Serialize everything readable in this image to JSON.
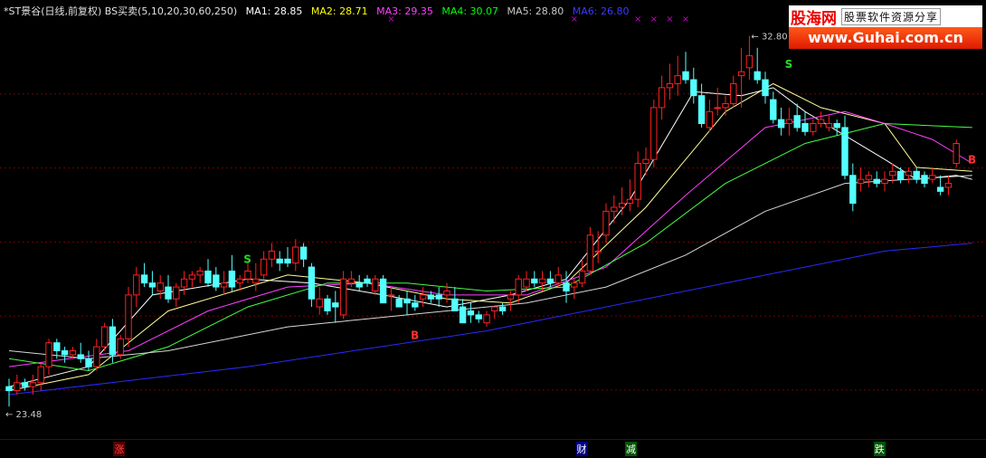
{
  "header": {
    "title": "*ST景谷(日线,前复权) BS买卖(5,10,20,30,60,250)",
    "ma": [
      {
        "label": "MA1: 28.85",
        "color": "#ffffff"
      },
      {
        "label": "MA2: 28.71",
        "color": "#ffff00"
      },
      {
        "label": "MA3: 29.35",
        "color": "#ff00ff"
      },
      {
        "label": "MA4: 30.07",
        "color": "#00ff00"
      },
      {
        "label": "MA5: 28.80",
        "color": "#c0c0c0"
      },
      {
        "label": "MA6: 26.80",
        "color": "#2a2aff"
      }
    ]
  },
  "logo": {
    "brand": "股海网",
    "slogan": "股票软件资源分享",
    "url": "www.Guhai.com.cn"
  },
  "events": [
    {
      "label": "涨",
      "color": "#ff4040",
      "bg": "#550000",
      "pos": 0.115
    },
    {
      "label": "财",
      "color": "#ffffff",
      "bg": "#000088",
      "pos": 0.584
    },
    {
      "label": "减",
      "color": "#ffffff",
      "bg": "#005500",
      "pos": 0.634
    },
    {
      "label": "跌",
      "color": "#ffffff",
      "bg": "#005500",
      "pos": 0.886
    }
  ],
  "chart_data": {
    "type": "candlestick",
    "ylim": [
      22.8,
      33.2
    ],
    "high_label": "32.80",
    "low_label": "23.48",
    "grid": true,
    "colors": {
      "up": "#ff2020",
      "down": "#54ffff",
      "grid": "#7a0000"
    },
    "candles": [
      [
        24.0,
        24.2,
        23.5,
        23.9
      ],
      [
        23.9,
        24.3,
        23.8,
        24.1
      ],
      [
        24.1,
        24.2,
        23.9,
        24.0
      ],
      [
        24.0,
        24.3,
        23.8,
        24.1
      ],
      [
        24.1,
        24.6,
        23.9,
        24.5
      ],
      [
        24.5,
        25.2,
        24.3,
        25.1
      ],
      [
        25.1,
        25.2,
        24.7,
        24.9
      ],
      [
        24.9,
        25.0,
        24.6,
        24.8
      ],
      [
        24.8,
        25.0,
        24.7,
        24.9
      ],
      [
        24.8,
        25.1,
        24.6,
        24.7
      ],
      [
        24.7,
        24.9,
        24.4,
        24.5
      ],
      [
        24.5,
        25.2,
        24.4,
        25.0
      ],
      [
        25.0,
        25.6,
        24.9,
        25.5
      ],
      [
        25.5,
        25.7,
        24.6,
        24.8
      ],
      [
        24.8,
        25.3,
        24.7,
        25.2
      ],
      [
        25.2,
        26.5,
        25.0,
        26.3
      ],
      [
        26.3,
        27.0,
        26.0,
        26.8
      ],
      [
        26.8,
        27.1,
        26.5,
        26.6
      ],
      [
        26.6,
        26.9,
        26.3,
        26.5
      ],
      [
        26.4,
        26.8,
        26.2,
        26.6
      ],
      [
        26.5,
        26.8,
        26.1,
        26.2
      ],
      [
        26.2,
        26.6,
        26.0,
        26.5
      ],
      [
        26.5,
        26.9,
        26.3,
        26.7
      ],
      [
        26.7,
        26.9,
        26.5,
        26.8
      ],
      [
        26.8,
        27.0,
        26.6,
        26.9
      ],
      [
        26.9,
        27.2,
        26.5,
        26.6
      ],
      [
        26.8,
        27.0,
        26.4,
        26.5
      ],
      [
        26.5,
        26.9,
        26.3,
        26.6
      ],
      [
        26.9,
        27.3,
        26.4,
        26.5
      ],
      [
        26.6,
        26.8,
        26.4,
        26.7
      ],
      [
        26.7,
        27.1,
        26.6,
        26.9
      ],
      [
        26.6,
        27.1,
        26.4,
        26.7
      ],
      [
        26.8,
        27.4,
        26.7,
        27.2
      ],
      [
        27.2,
        27.6,
        27.0,
        27.4
      ],
      [
        27.2,
        27.4,
        26.9,
        27.1
      ],
      [
        27.2,
        27.5,
        27.0,
        27.1
      ],
      [
        27.1,
        27.7,
        26.9,
        27.5
      ],
      [
        27.5,
        27.6,
        27.0,
        27.2
      ],
      [
        27.0,
        27.1,
        26.0,
        26.2
      ],
      [
        26.0,
        26.5,
        25.8,
        26.2
      ],
      [
        26.2,
        26.3,
        25.8,
        25.9
      ],
      [
        26.1,
        26.4,
        25.6,
        26.0
      ],
      [
        25.8,
        26.9,
        25.7,
        26.7
      ],
      [
        26.6,
        26.9,
        26.5,
        26.7
      ],
      [
        26.6,
        26.8,
        26.4,
        26.5
      ],
      [
        26.7,
        26.8,
        26.5,
        26.6
      ],
      [
        26.4,
        26.8,
        26.3,
        26.7
      ],
      [
        26.7,
        26.8,
        26.1,
        26.1
      ],
      [
        26.3,
        26.5,
        25.9,
        26.3
      ],
      [
        26.2,
        26.3,
        26.0,
        26.0
      ],
      [
        26.2,
        26.4,
        25.8,
        26.1
      ],
      [
        26.1,
        26.3,
        25.9,
        26.0
      ],
      [
        26.2,
        26.5,
        26.0,
        26.3
      ],
      [
        26.3,
        26.4,
        26.1,
        26.2
      ],
      [
        26.3,
        26.5,
        26.0,
        26.2
      ],
      [
        26.3,
        26.6,
        26.1,
        26.4
      ],
      [
        26.2,
        26.5,
        25.9,
        25.9
      ],
      [
        26.0,
        26.2,
        25.6,
        25.6
      ],
      [
        25.9,
        26.1,
        25.6,
        25.8
      ],
      [
        25.8,
        25.9,
        25.6,
        25.7
      ],
      [
        25.6,
        25.9,
        25.5,
        25.8
      ],
      [
        25.9,
        26.0,
        25.7,
        26.0
      ],
      [
        26.0,
        26.1,
        25.8,
        25.9
      ],
      [
        26.2,
        26.4,
        25.9,
        26.3
      ],
      [
        26.3,
        26.8,
        26.1,
        26.7
      ],
      [
        26.5,
        26.9,
        26.4,
        26.7
      ],
      [
        26.7,
        26.9,
        26.5,
        26.6
      ],
      [
        26.6,
        26.9,
        26.4,
        26.7
      ],
      [
        26.7,
        26.9,
        26.5,
        26.6
      ],
      [
        26.6,
        27.0,
        26.5,
        26.8
      ],
      [
        26.6,
        26.9,
        26.1,
        26.4
      ],
      [
        26.5,
        26.7,
        26.2,
        26.6
      ],
      [
        26.6,
        27.2,
        26.5,
        26.9
      ],
      [
        26.9,
        28.0,
        26.8,
        27.8
      ],
      [
        27.4,
        27.9,
        27.1,
        27.4
      ],
      [
        27.8,
        28.6,
        27.6,
        28.4
      ],
      [
        28.4,
        28.8,
        28.1,
        28.5
      ],
      [
        28.5,
        29.0,
        28.3,
        28.6
      ],
      [
        28.6,
        29.2,
        28.4,
        28.7
      ],
      [
        28.7,
        29.9,
        28.5,
        29.6
      ],
      [
        29.6,
        30.0,
        29.3,
        29.7
      ],
      [
        29.7,
        31.2,
        29.5,
        31.0
      ],
      [
        31.0,
        31.8,
        30.7,
        31.5
      ],
      [
        31.5,
        32.1,
        31.2,
        31.6
      ],
      [
        31.6,
        32.3,
        31.3,
        31.8
      ],
      [
        31.9,
        32.4,
        31.6,
        31.7
      ],
      [
        31.7,
        32.0,
        31.1,
        31.3
      ],
      [
        31.3,
        31.6,
        30.5,
        30.6
      ],
      [
        30.5,
        31.2,
        30.4,
        30.9
      ],
      [
        31.0,
        31.5,
        30.8,
        31.0
      ],
      [
        31.0,
        31.3,
        30.8,
        31.1
      ],
      [
        31.1,
        31.8,
        31.0,
        31.6
      ],
      [
        31.8,
        32.5,
        31.0,
        31.9
      ],
      [
        32.0,
        32.8,
        31.7,
        32.3
      ],
      [
        31.9,
        32.5,
        31.6,
        31.7
      ],
      [
        31.7,
        31.9,
        31.1,
        31.3
      ],
      [
        31.2,
        31.4,
        30.6,
        30.7
      ],
      [
        30.7,
        31.0,
        30.3,
        30.5
      ],
      [
        30.6,
        31.0,
        30.3,
        30.7
      ],
      [
        30.8,
        31.1,
        30.4,
        30.5
      ],
      [
        30.6,
        30.9,
        30.3,
        30.4
      ],
      [
        30.4,
        30.7,
        30.3,
        30.6
      ],
      [
        30.6,
        30.9,
        30.5,
        30.7
      ],
      [
        30.5,
        30.8,
        30.4,
        30.6
      ],
      [
        30.6,
        30.7,
        30.3,
        30.5
      ],
      [
        30.5,
        30.8,
        29.2,
        29.3
      ],
      [
        29.3,
        29.6,
        28.4,
        28.6
      ],
      [
        29.1,
        29.5,
        28.9,
        29.2
      ],
      [
        29.2,
        29.4,
        29.0,
        29.3
      ],
      [
        29.2,
        29.4,
        29.0,
        29.1
      ],
      [
        29.1,
        29.4,
        28.9,
        29.2
      ],
      [
        29.3,
        29.6,
        29.1,
        29.4
      ],
      [
        29.4,
        29.5,
        29.1,
        29.2
      ],
      [
        29.3,
        29.5,
        29.1,
        29.4
      ],
      [
        29.4,
        29.5,
        29.1,
        29.2
      ],
      [
        29.3,
        29.4,
        29.0,
        29.1
      ],
      [
        29.2,
        29.5,
        29.1,
        29.3
      ],
      [
        29.0,
        29.3,
        28.8,
        28.9
      ],
      [
        29.0,
        29.3,
        28.8,
        29.1
      ],
      [
        29.6,
        30.2,
        29.5,
        30.1
      ]
    ],
    "ma_lines": [
      {
        "name": "MA1",
        "color": "#ffffff",
        "points": [
          [
            0,
            24.0
          ],
          [
            10,
            24.5
          ],
          [
            18,
            26.3
          ],
          [
            30,
            26.7
          ],
          [
            38,
            26.6
          ],
          [
            47,
            26.3
          ],
          [
            55,
            26.0
          ],
          [
            63,
            26.3
          ],
          [
            70,
            26.7
          ],
          [
            78,
            28.7
          ],
          [
            86,
            31.4
          ],
          [
            92,
            31.3
          ],
          [
            96,
            31.5
          ],
          [
            100,
            30.9
          ],
          [
            110,
            29.7
          ],
          [
            114,
            29.2
          ],
          [
            119,
            29.3
          ],
          [
            121,
            29.2
          ]
        ]
      },
      {
        "name": "MA2",
        "color": "#ffff99",
        "points": [
          [
            0,
            23.9
          ],
          [
            10,
            24.3
          ],
          [
            20,
            25.9
          ],
          [
            35,
            26.8
          ],
          [
            45,
            26.6
          ],
          [
            55,
            26.2
          ],
          [
            63,
            26.1
          ],
          [
            70,
            26.6
          ],
          [
            80,
            28.5
          ],
          [
            90,
            30.9
          ],
          [
            96,
            31.6
          ],
          [
            102,
            31.0
          ],
          [
            110,
            30.6
          ],
          [
            114,
            29.5
          ],
          [
            121,
            29.4
          ]
        ]
      },
      {
        "name": "MA3",
        "color": "#ff40ff",
        "points": [
          [
            0,
            24.5
          ],
          [
            15,
            24.9
          ],
          [
            25,
            25.9
          ],
          [
            35,
            26.5
          ],
          [
            45,
            26.6
          ],
          [
            55,
            26.3
          ],
          [
            65,
            26.3
          ],
          [
            75,
            27.0
          ],
          [
            85,
            28.8
          ],
          [
            95,
            30.5
          ],
          [
            105,
            30.9
          ],
          [
            110,
            30.6
          ],
          [
            116,
            30.2
          ],
          [
            121,
            29.6
          ]
        ]
      },
      {
        "name": "MA4",
        "color": "#44ff44",
        "points": [
          [
            0,
            24.7
          ],
          [
            10,
            24.4
          ],
          [
            20,
            25.0
          ],
          [
            30,
            26.0
          ],
          [
            40,
            26.6
          ],
          [
            50,
            26.6
          ],
          [
            60,
            26.4
          ],
          [
            70,
            26.5
          ],
          [
            80,
            27.6
          ],
          [
            90,
            29.1
          ],
          [
            100,
            30.1
          ],
          [
            110,
            30.6
          ],
          [
            121,
            30.5
          ]
        ]
      },
      {
        "name": "MA5",
        "color": "#d8d8d8",
        "points": [
          [
            0,
            24.9
          ],
          [
            10,
            24.7
          ],
          [
            20,
            24.9
          ],
          [
            35,
            25.5
          ],
          [
            50,
            25.8
          ],
          [
            65,
            26.1
          ],
          [
            75,
            26.5
          ],
          [
            85,
            27.3
          ],
          [
            95,
            28.4
          ],
          [
            105,
            29.1
          ],
          [
            121,
            29.3
          ]
        ]
      },
      {
        "name": "MA6",
        "color": "#2a2aff",
        "points": [
          [
            0,
            23.8
          ],
          [
            30,
            24.5
          ],
          [
            60,
            25.4
          ],
          [
            90,
            26.6
          ],
          [
            110,
            27.4
          ],
          [
            121,
            27.6
          ]
        ]
      }
    ],
    "signals": [
      {
        "label": "S",
        "color": "#22dd22",
        "i": 29,
        "y": 27.1
      },
      {
        "label": "B",
        "color": "#ff3030",
        "i": 50,
        "y": 25.2
      },
      {
        "label": "S",
        "color": "#22dd22",
        "i": 97,
        "y": 32.0
      },
      {
        "label": "B",
        "color": "#ff3030",
        "i": 120,
        "y": 29.6
      }
    ],
    "markers": [
      {
        "label": "×",
        "color": "#cc00cc",
        "i": 48
      },
      {
        "label": "×",
        "color": "#cc00cc",
        "i": 71
      },
      {
        "label": "×",
        "color": "#cc00cc",
        "i": 79
      },
      {
        "label": "×",
        "color": "#cc00cc",
        "i": 81
      },
      {
        "label": "×",
        "color": "#cc00cc",
        "i": 83
      },
      {
        "label": "×",
        "color": "#cc00cc",
        "i": 85
      }
    ]
  }
}
